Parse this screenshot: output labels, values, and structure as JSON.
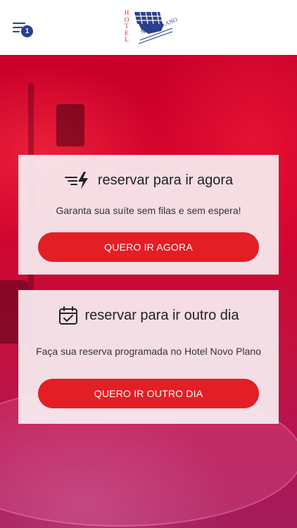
{
  "header": {
    "menu_badge": "1",
    "logo": {
      "line1": "HOTEL",
      "line2": "NOVO PLANO"
    }
  },
  "cards": [
    {
      "title": "reservar para ir agora",
      "icon": "fast-bolt-icon",
      "description": "Garanta sua suíte sem filas e sem espera!",
      "button_label": "QUERO IR AGORA"
    },
    {
      "title": "reservar para ir outro dia",
      "icon": "calendar-check-icon",
      "description": "Faça sua reserva programada no Hotel Novo Plano",
      "button_label": "QUERO IR OUTRO DIA"
    }
  ],
  "colors": {
    "brand_blue": "#2b3f8f",
    "button_red": "#e31e24",
    "hero_red": "#c9002a"
  }
}
